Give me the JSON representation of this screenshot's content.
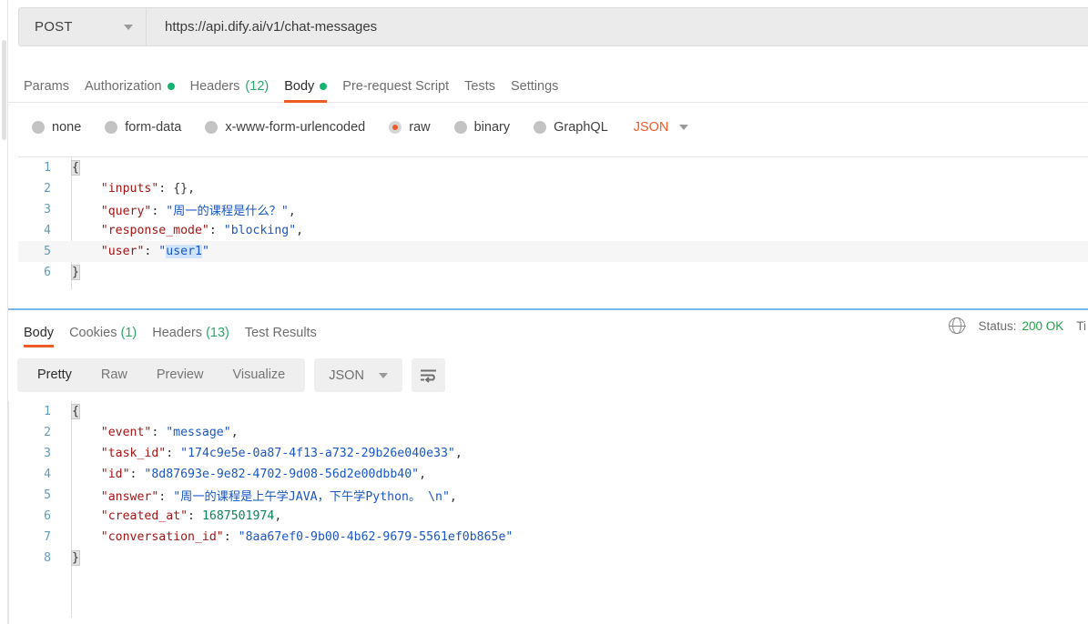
{
  "request": {
    "method": "POST",
    "url": "https://api.dify.ai/v1/chat-messages",
    "tabs": [
      {
        "label": "Params",
        "dot": false,
        "count": ""
      },
      {
        "label": "Authorization",
        "dot": true,
        "count": ""
      },
      {
        "label": "Headers",
        "dot": false,
        "count": "(12)"
      },
      {
        "label": "Body",
        "dot": true,
        "count": ""
      },
      {
        "label": "Pre-request Script",
        "dot": false,
        "count": ""
      },
      {
        "label": "Tests",
        "dot": false,
        "count": ""
      },
      {
        "label": "Settings",
        "dot": false,
        "count": ""
      }
    ],
    "active_tab": "Body",
    "body_types": [
      {
        "label": "none",
        "selected": false
      },
      {
        "label": "form-data",
        "selected": false
      },
      {
        "label": "x-www-form-urlencoded",
        "selected": false
      },
      {
        "label": "raw",
        "selected": true
      },
      {
        "label": "binary",
        "selected": false
      },
      {
        "label": "GraphQL",
        "selected": false
      }
    ],
    "raw_format": "JSON",
    "editor": {
      "lines": [
        "1",
        "2",
        "3",
        "4",
        "5",
        "6"
      ],
      "code": {
        "l1_brace": "{",
        "l2_key": "\"inputs\"",
        "l2_colon": ": ",
        "l2_val": "{}",
        "l2_comma": ",",
        "l3_key": "\"query\"",
        "l3_colon": ": ",
        "l3_val": "\"周一的课程是什么？\"",
        "l3_comma": ",",
        "l4_key": "\"response_mode\"",
        "l4_colon": ": ",
        "l4_val": "\"blocking\"",
        "l4_comma": ",",
        "l5_key": "\"user\"",
        "l5_colon": ": ",
        "l5_quote_open": "\"",
        "l5_val": "user1",
        "l5_quote_close": "\"",
        "l6_brace": "}"
      }
    }
  },
  "response": {
    "tabs": [
      {
        "label": "Body",
        "count": ""
      },
      {
        "label": "Cookies",
        "count": "(1)"
      },
      {
        "label": "Headers",
        "count": "(13)"
      },
      {
        "label": "Test Results",
        "count": ""
      }
    ],
    "active_tab": "Body",
    "status_label": "Status:",
    "status_value": "200 OK",
    "time_label": "Ti",
    "globe_icon": "globe-icon",
    "view_modes": [
      {
        "label": "Pretty",
        "active": true
      },
      {
        "label": "Raw",
        "active": false
      },
      {
        "label": "Preview",
        "active": false
      },
      {
        "label": "Visualize",
        "active": false
      }
    ],
    "format": "JSON",
    "wrap_icon": "word-wrap-icon",
    "editor": {
      "lines": [
        "1",
        "2",
        "3",
        "4",
        "5",
        "6",
        "7",
        "8"
      ],
      "code": {
        "l1_brace": "{",
        "l2_key": "\"event\"",
        "l2_colon": ": ",
        "l2_val": "\"message\"",
        "l2_comma": ",",
        "l3_key": "\"task_id\"",
        "l3_colon": ": ",
        "l3_val": "\"174c9e5e-0a87-4f13-a732-29b26e040e33\"",
        "l3_comma": ",",
        "l4_key": "\"id\"",
        "l4_colon": ": ",
        "l4_val": "\"8d87693e-9e82-4702-9d08-56d2e00dbb40\"",
        "l4_comma": ",",
        "l5_key": "\"answer\"",
        "l5_colon": ": ",
        "l5_val": "\"周一的课程是上午学JAVA，下午学Python。 \\n\"",
        "l5_comma": ",",
        "l6_key": "\"created_at\"",
        "l6_colon": ": ",
        "l6_val": "1687501974",
        "l6_comma": ",",
        "l7_key": "\"conversation_id\"",
        "l7_colon": ": ",
        "l7_val": "\"8aa67ef0-9b00-4b62-9679-5561ef0b865e\"",
        "l8_brace": "}"
      }
    }
  }
}
